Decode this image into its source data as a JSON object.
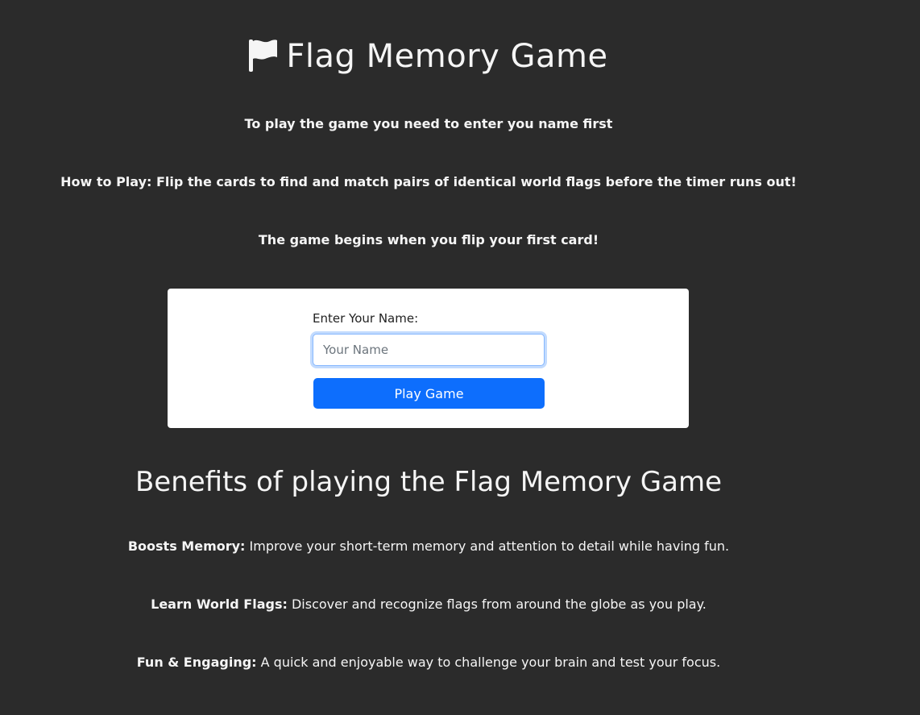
{
  "header": {
    "title": "Flag Memory Game",
    "icon": "flag-icon"
  },
  "intro": {
    "line1": "To play the game you need to enter you name first",
    "line2": "How to Play: Flip the cards to find and match pairs of identical world flags before the timer runs out!",
    "line3": "The game begins when you flip your first card!"
  },
  "form": {
    "label": "Enter Your Name:",
    "placeholder": "Your Name",
    "value": "",
    "button_label": "Play Game"
  },
  "benefits": {
    "title": "Benefits of playing the Flag Memory Game",
    "items": [
      {
        "heading": "Boosts Memory:",
        "text": " Improve your short-term memory and attention to detail while having fun."
      },
      {
        "heading": "Learn World Flags:",
        "text": " Discover and recognize flags from around the globe as you play."
      },
      {
        "heading": "Fun & Engaging:",
        "text": " A quick and enjoyable way to challenge your brain and test your focus."
      }
    ]
  },
  "colors": {
    "background": "#2b2b2b",
    "card": "#ffffff",
    "button": "#0d6efd",
    "text": "#f5f5f5"
  }
}
